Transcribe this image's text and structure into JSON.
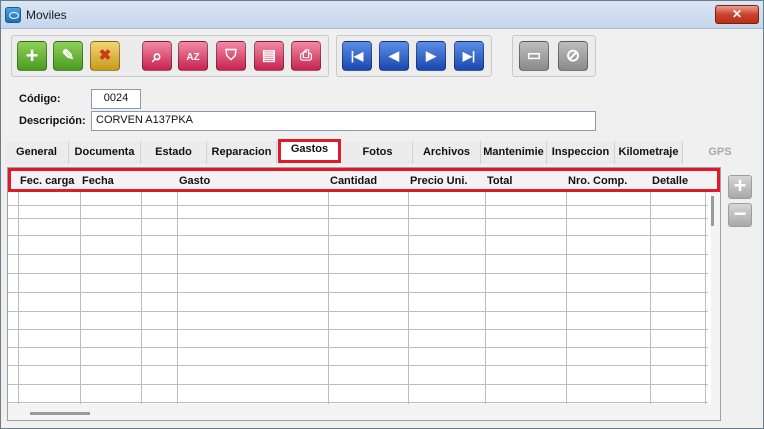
{
  "window": {
    "title": "Moviles",
    "close_label": "✕"
  },
  "toolbar": {
    "add_label": "+",
    "edit_label": "✎",
    "delete_label": "✖",
    "search_label": "⌕",
    "sort_label": "AZ",
    "filter_label": "⛉",
    "report_label": "▤",
    "print_label": "⎙",
    "first_label": "|◀",
    "prev_label": "◀",
    "next_label": "▶",
    "last_label": "▶|",
    "save_label": "▭",
    "cancel_label": "⊘"
  },
  "form": {
    "codigo_label": "Código:",
    "codigo_value": "0024",
    "descripcion_label": "Descripción:",
    "descripcion_value": "CORVEN A137PKA"
  },
  "tabs": [
    {
      "label": "General"
    },
    {
      "label": "Documenta"
    },
    {
      "label": "Estado"
    },
    {
      "label": "Reparacion"
    },
    {
      "label": "Gastos"
    },
    {
      "label": "Fotos"
    },
    {
      "label": "Archivos"
    },
    {
      "label": "Mantenimie"
    },
    {
      "label": "Inspeccion"
    },
    {
      "label": "Kilometraje"
    },
    {
      "label": "GPS"
    }
  ],
  "grid": {
    "columns": [
      {
        "label": "Fec. carga"
      },
      {
        "label": "Fecha"
      },
      {
        "label": "Gasto"
      },
      {
        "label": "Cantidad"
      },
      {
        "label": "Precio Uni."
      },
      {
        "label": "Total"
      },
      {
        "label": "Nro. Comp."
      },
      {
        "label": "Detalle"
      }
    ]
  },
  "side": {
    "add_row_label": "+",
    "remove_row_label": "−"
  }
}
